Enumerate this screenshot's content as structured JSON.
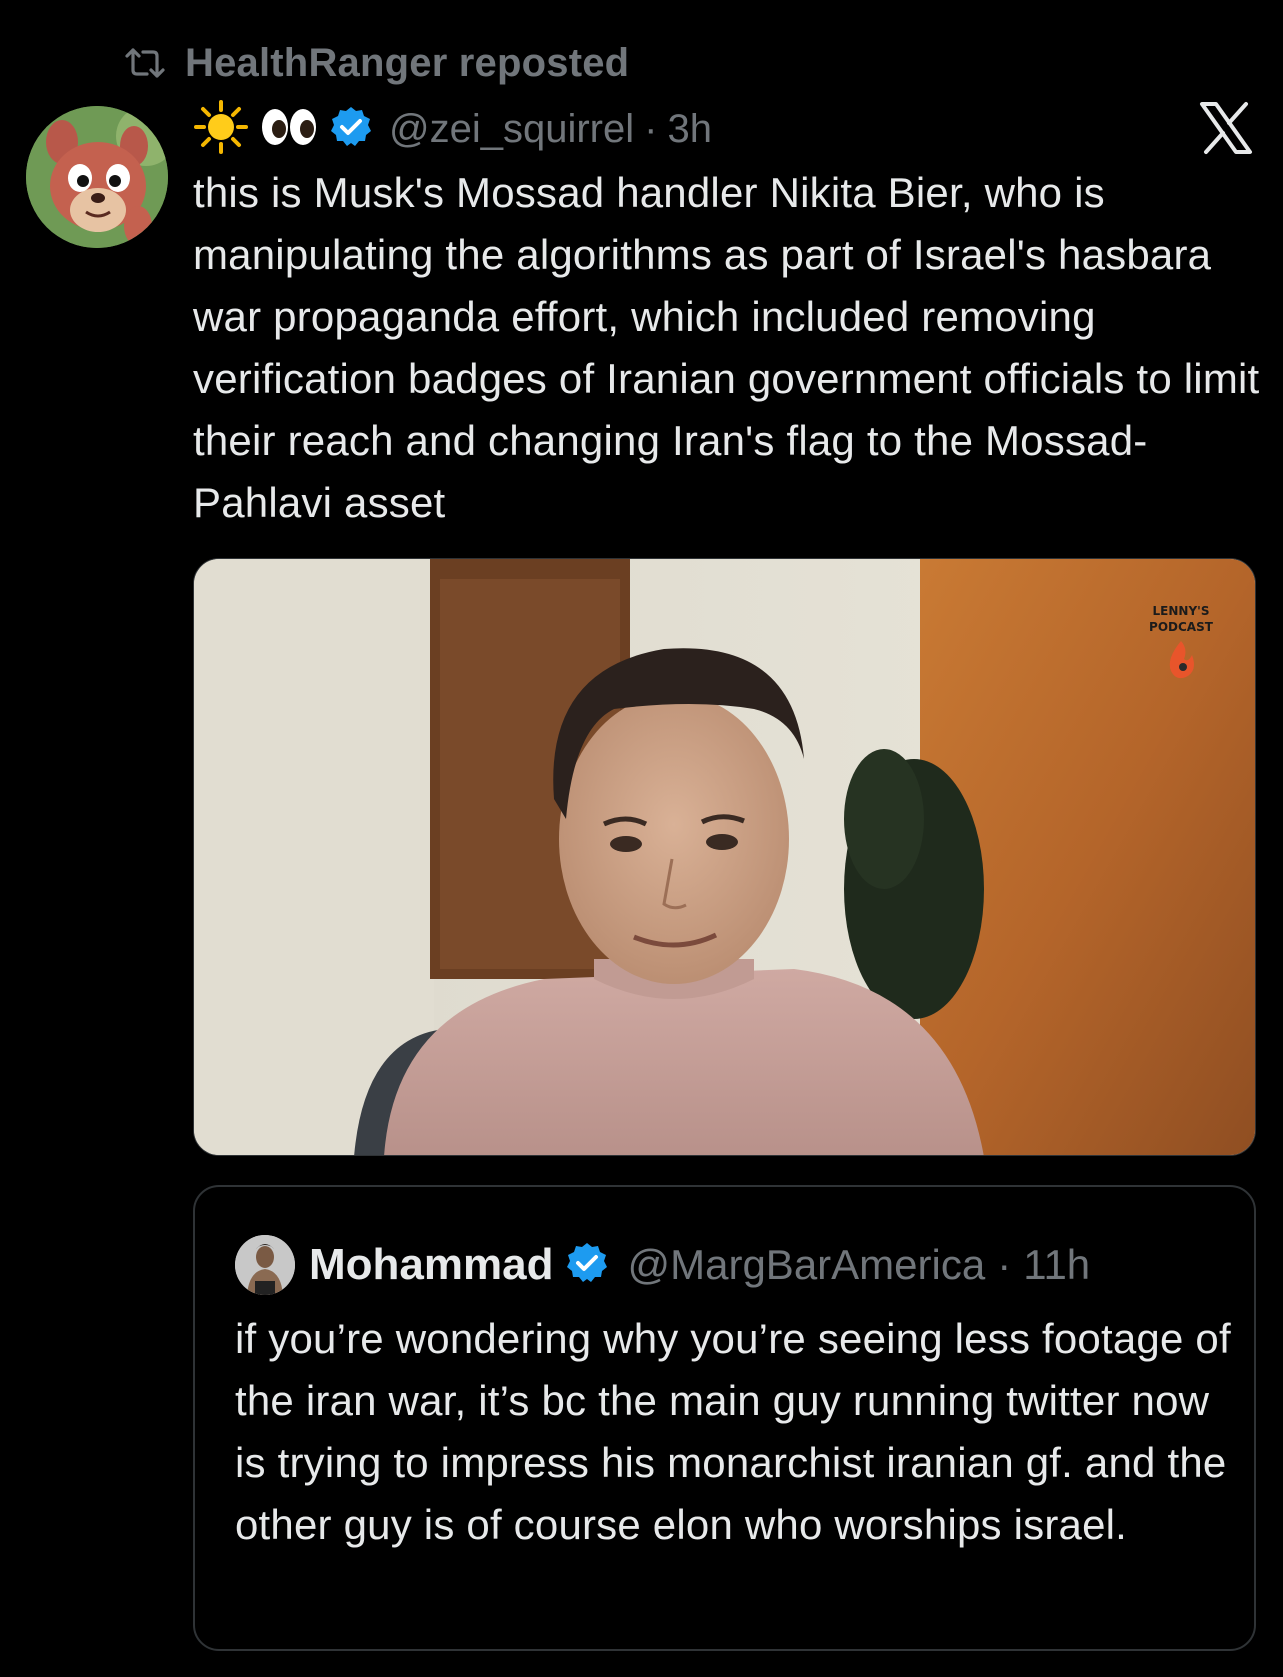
{
  "repost": {
    "label": "HealthRanger reposted"
  },
  "post": {
    "name_emoji": "☀️👀",
    "handle": "@zei_squirrel",
    "separator": "·",
    "time": "3h",
    "text": "this is Musk's Mossad handler Nikita Bier, who is manipulating the algorithms as part of Israel's hasbara war propaganda effort, which included removing verification badges of Iranian government officials to limit their reach and changing Iran's flag to the Mossad-Pahlavi asset",
    "media": {
      "watermark_top": "LENNY'S",
      "watermark_bottom": "PODCAST"
    }
  },
  "quoted": {
    "name": "Mohammad",
    "handle": "@MargBarAmerica",
    "separator": "·",
    "time": "11h",
    "text": "if you’re wondering why you’re seeing less footage of the iran war, it’s bc the main guy running twitter now is trying to impress his monarchist iranian gf. and the other guy is of course elon who worships israel."
  },
  "icons": {
    "repost": "repost-icon",
    "verified": "verified-badge-icon",
    "platform": "x-logo-icon"
  },
  "colors": {
    "background": "#000000",
    "text_primary": "#e7e9ea",
    "text_secondary": "#71767b",
    "verified_blue": "#1d9bf0",
    "border": "#2f3336"
  }
}
